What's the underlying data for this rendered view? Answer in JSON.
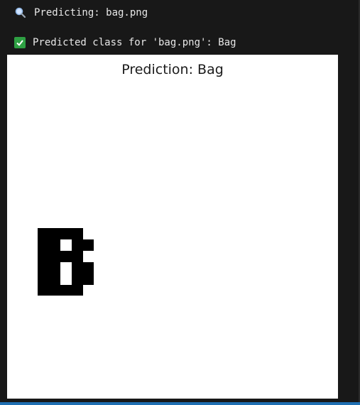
{
  "log": {
    "line1": {
      "icon": "magnifier-icon",
      "text": "Predicting: bag.png"
    },
    "line2": {
      "icon": "check-icon",
      "text": "Predicted class for 'bag.png': Bag"
    }
  },
  "plot": {
    "title": "Prediction: Bag",
    "image_description_icon": "pixel-glyph-image"
  },
  "colors": {
    "background": "#181818",
    "text": "#e8e8e8",
    "check": "#2ea043",
    "panel": "#ffffff"
  }
}
